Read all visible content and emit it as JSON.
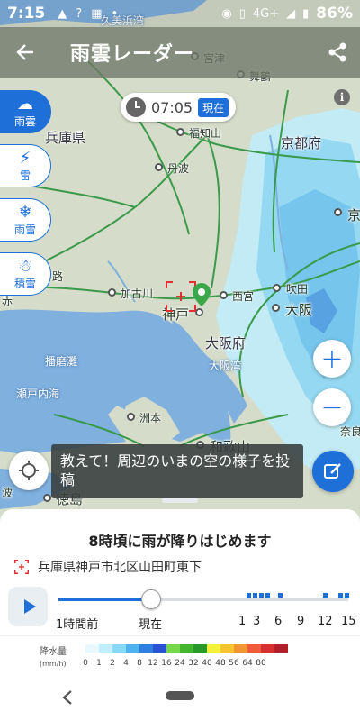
{
  "status_bar": {
    "time": "7:15",
    "network": "4G+",
    "battery": "86%"
  },
  "app_bar": {
    "title": "雨雲レーダー"
  },
  "time_display": {
    "time": "07:05",
    "now_label": "現在"
  },
  "map_labels": [
    {
      "text": "久美浜湾",
      "kind": "water"
    },
    {
      "text": "宮津",
      "kind": "city"
    },
    {
      "text": "舞鶴",
      "kind": "city"
    },
    {
      "text": "兵庫県",
      "kind": "pref"
    },
    {
      "text": "福知山",
      "kind": "city"
    },
    {
      "text": "京都府",
      "kind": "pref"
    },
    {
      "text": "丹波",
      "kind": "city"
    },
    {
      "text": "京",
      "kind": "city"
    },
    {
      "text": "路",
      "kind": "city"
    },
    {
      "text": "加古川",
      "kind": "city"
    },
    {
      "text": "西宮",
      "kind": "city"
    },
    {
      "text": "吹田",
      "kind": "city"
    },
    {
      "text": "神戸",
      "kind": "big"
    },
    {
      "text": "大阪",
      "kind": "big"
    },
    {
      "text": "大阪府",
      "kind": "pref"
    },
    {
      "text": "播磨灘",
      "kind": "water"
    },
    {
      "text": "大阪湾",
      "kind": "water"
    },
    {
      "text": "瀬戸内海",
      "kind": "water"
    },
    {
      "text": "洲本",
      "kind": "city"
    },
    {
      "text": "和歌山",
      "kind": "big"
    },
    {
      "text": "奈良",
      "kind": "city"
    },
    {
      "text": "徳島",
      "kind": "big"
    },
    {
      "text": "赤",
      "kind": "city"
    },
    {
      "text": "波",
      "kind": "city"
    }
  ],
  "layers": [
    {
      "label": "雨雲",
      "icon": "cloud-rain-icon",
      "glyph": "☁",
      "active": true
    },
    {
      "label": "雷",
      "icon": "lightning-icon",
      "glyph": "⚡",
      "active": false
    },
    {
      "label": "雨雪",
      "icon": "snow-rain-icon",
      "glyph": "❄",
      "active": false
    },
    {
      "label": "積雪",
      "icon": "snow-accumulation-icon",
      "glyph": "☃",
      "active": false
    }
  ],
  "zoom": {
    "in": "+",
    "out": "−"
  },
  "post_banner": {
    "text": "教えて！周辺のいまの空の様子を投稿"
  },
  "forecast": {
    "message": "8時頃に雨が降りはじめます",
    "location": "兵庫県神戸市北区山田町東下"
  },
  "timeline": {
    "start_label": "1時間前",
    "now_label": "現在",
    "hour_labels": [
      "1",
      "3",
      "6",
      "9",
      "12",
      "15"
    ],
    "current_fraction": 0.32
  },
  "legend": {
    "title": "降水量",
    "unit": "(mm/h)",
    "values": [
      "0",
      "1",
      "2",
      "4",
      "8",
      "12",
      "16",
      "24",
      "32",
      "40",
      "48",
      "56",
      "64",
      "80"
    ],
    "colors": [
      "#e9f8ff",
      "#bfeefe",
      "#8ad8f8",
      "#4fb3f0",
      "#2d7fe0",
      "#2c52d4",
      "#77d94a",
      "#45b530",
      "#299a2a",
      "#f5f13b",
      "#f6c42f",
      "#f29533",
      "#ee5a3a",
      "#d83030",
      "#b01f2a"
    ]
  },
  "colors": {
    "accent": "#1e6fd8",
    "marker": "#3aa84a",
    "target": "#e03030"
  }
}
